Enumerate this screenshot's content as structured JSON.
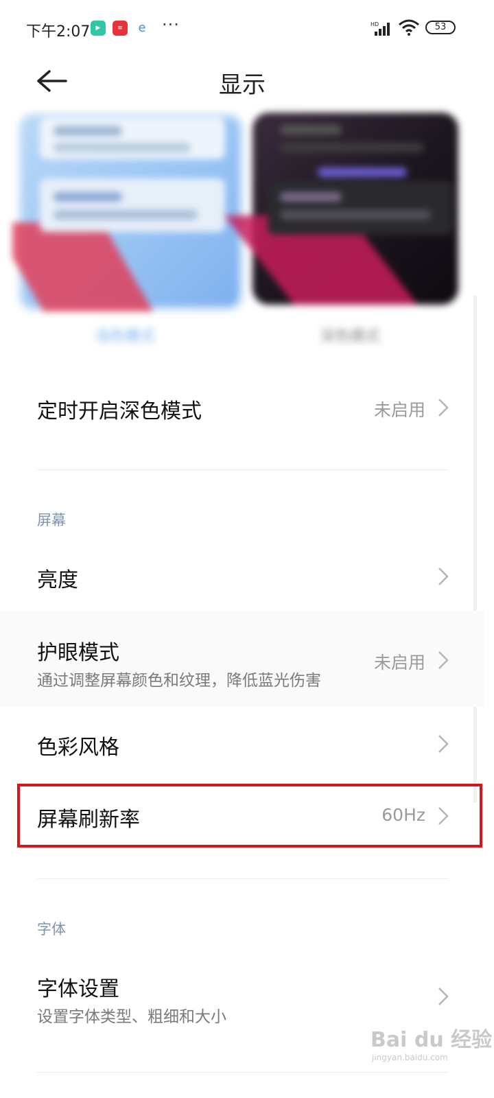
{
  "status_bar": {
    "time": "下午2:07",
    "battery": "53",
    "app_icons": [
      "video-app-icon",
      "news-app-icon",
      "browser-app-icon"
    ],
    "more": "···"
  },
  "header": {
    "title": "显示"
  },
  "theme_preview": {
    "light_label": "浅色模式",
    "dark_label": "深色模式"
  },
  "dark_schedule": {
    "title": "定时开启深色模式",
    "value": "未启用"
  },
  "screen_section": {
    "label": "屏幕",
    "items": [
      {
        "title": "亮度"
      },
      {
        "title": "护眼模式",
        "subtitle": "通过调整屏幕颜色和纹理，降低蓝光伤害",
        "value": "未启用"
      },
      {
        "title": "色彩风格"
      },
      {
        "title": "屏幕刷新率",
        "value": "60Hz"
      }
    ]
  },
  "font_section": {
    "label": "字体",
    "items": [
      {
        "title": "字体设置",
        "subtitle": "设置字体类型、粗细和大小"
      }
    ]
  },
  "watermark": {
    "brand": "Bai du 经验",
    "url": "jingyan.baidu.com"
  },
  "colors": {
    "highlight": "#d4161d",
    "accent": "#7eb3ef",
    "section_label": "#8093ad"
  }
}
